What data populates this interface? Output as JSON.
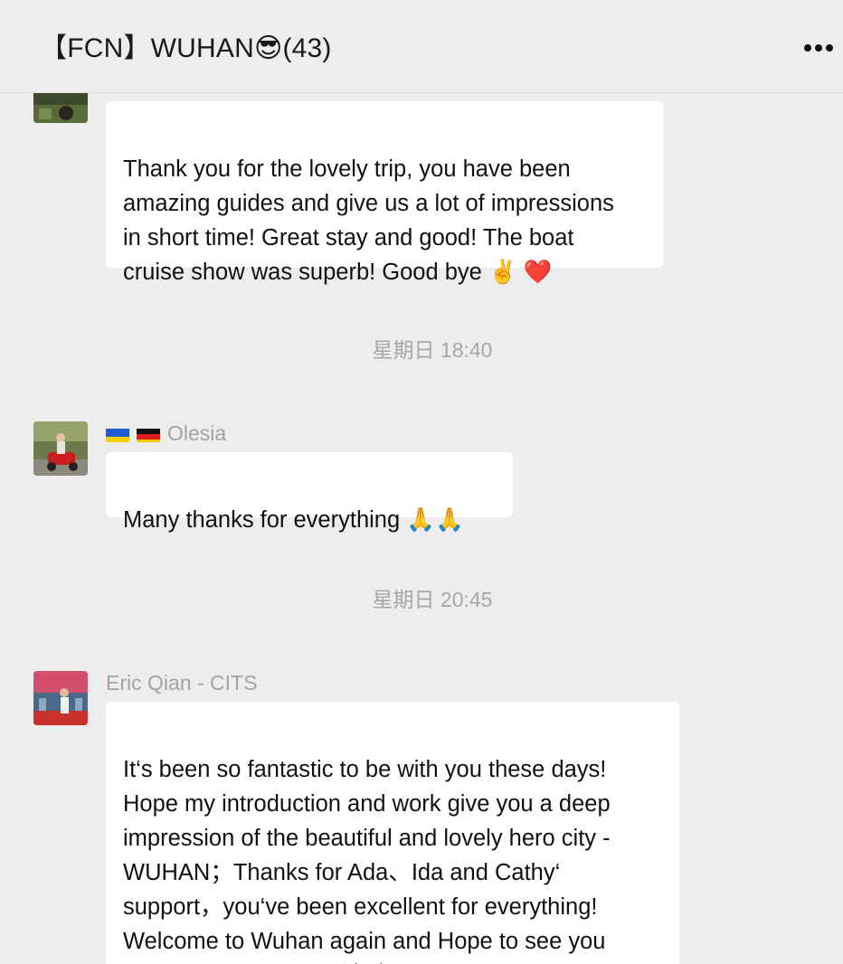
{
  "header": {
    "title": "【FCN】WUHAN😎(43)",
    "more_icon": "more-horizontal-icon"
  },
  "messages": [
    {
      "text": "Thank you for the lovely trip, you have been\namazing guides and give us a lot of impressions\nin short time! Great stay and good! The boat\ncruise show was superb! Good bye ✌️ ❤️"
    },
    {
      "sender": "Olesia",
      "sender_flags": [
        "ukraine-flag",
        "germany-flag"
      ],
      "text": "Many thanks for everything 🙏🙏"
    },
    {
      "sender": "Eric Qian - CITS",
      "text": "It‘s been so fantastic to be with you these days!\nHope my introduction and work give you a deep\nimpression of the beautiful and lovely hero city -\nWUHAN；Thanks for Ada、Ida and Cathy‘\nsupport，you‘ve been excellent for everything!\nWelcome to Wuhan again and Hope to see you\nguys soon！ 😜🀅@所有人"
    }
  ],
  "timestamps": [
    "星期日 18:40",
    "星期日 20:45"
  ],
  "colors": {
    "background": "#ededed",
    "bubble": "#ffffff",
    "sender_text": "#a3a3a3",
    "timestamp_text": "#a6a6a6"
  }
}
